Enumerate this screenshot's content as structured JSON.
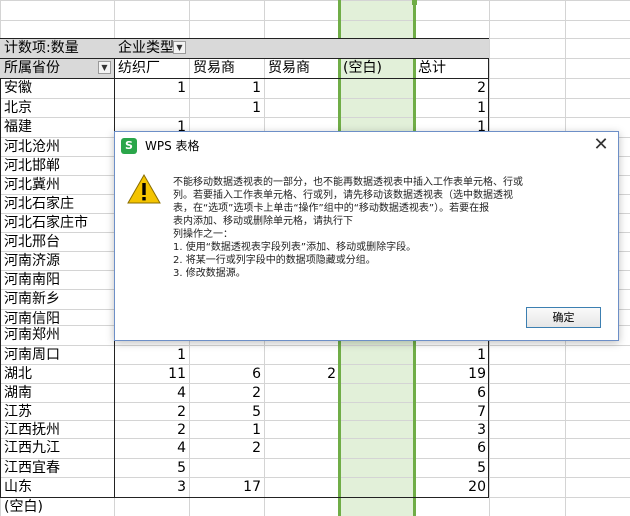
{
  "pivot": {
    "count_label": "计数项:数量",
    "col_field": "企业类型",
    "row_field": "所属省份",
    "col_headers": [
      "纺织厂",
      "贸易商",
      "贸易商",
      "(空白)",
      "总计"
    ],
    "rows": [
      {
        "name": "安徽",
        "vals": [
          "1",
          "1",
          "",
          "",
          "2"
        ]
      },
      {
        "name": "北京",
        "vals": [
          "",
          "1",
          "",
          "",
          "1"
        ]
      },
      {
        "name": "福建",
        "vals": [
          "1",
          "",
          "",
          "",
          "1"
        ]
      },
      {
        "name": "河北沧州",
        "vals": [
          "",
          "",
          "",
          "",
          ""
        ]
      },
      {
        "name": "河北邯郸",
        "vals": [
          "",
          "",
          "",
          "",
          ""
        ]
      },
      {
        "name": "河北冀州",
        "vals": [
          "",
          "",
          "",
          "",
          ""
        ]
      },
      {
        "name": "河北石家庄",
        "vals": [
          "",
          "",
          "",
          "",
          ""
        ]
      },
      {
        "name": "河北石家庄市",
        "vals": [
          "",
          "",
          "",
          "",
          ""
        ]
      },
      {
        "name": "河北邢台",
        "vals": [
          "",
          "",
          "",
          "",
          ""
        ]
      },
      {
        "name": "河南济源",
        "vals": [
          "",
          "",
          "",
          "",
          ""
        ]
      },
      {
        "name": "河南南阳",
        "vals": [
          "",
          "",
          "",
          "",
          ""
        ]
      },
      {
        "name": "河南新乡",
        "vals": [
          "",
          "",
          "",
          "",
          ""
        ]
      },
      {
        "name": "河南信阳",
        "vals": [
          "",
          "",
          "",
          "",
          ""
        ]
      },
      {
        "name": "河南郑州",
        "vals": [
          "",
          "",
          "",
          "",
          ""
        ]
      },
      {
        "name": "河南周口",
        "vals": [
          "1",
          "",
          "",
          "",
          "1"
        ]
      },
      {
        "name": "湖北",
        "vals": [
          "11",
          "6",
          "2",
          "",
          "19"
        ]
      },
      {
        "name": "湖南",
        "vals": [
          "4",
          "2",
          "",
          "",
          "6"
        ]
      },
      {
        "name": "江苏",
        "vals": [
          "2",
          "5",
          "",
          "",
          "7"
        ]
      },
      {
        "name": "江西抚州",
        "vals": [
          "2",
          "1",
          "",
          "",
          "3"
        ]
      },
      {
        "name": "江西九江",
        "vals": [
          "4",
          "2",
          "",
          "",
          "6"
        ]
      },
      {
        "name": "江西宜春",
        "vals": [
          "5",
          "",
          "",
          "",
          "5"
        ]
      },
      {
        "name": "山东",
        "vals": [
          "3",
          "17",
          "",
          "",
          "20"
        ]
      },
      {
        "name": "(空白)",
        "vals": [
          "",
          "",
          "",
          "",
          ""
        ]
      }
    ]
  },
  "dialog": {
    "title": "WPS 表格",
    "message_lines": [
      "不能移动数据透视表的一部分，也不能再数据透视表中插入工作表单元格、行或",
      "列。若要插入工作表单元格、行或列，请先移动该数据透视表（选中数据透视",
      "表，在“选项”选项卡上单击“操作”组中的“移动数据透视表”）。若要在报",
      "表内添加、移动或删除单元格，请执行下",
      "列操作之一：",
      "1. 使用“数据透视表字段列表”添加、移动或删除字段。",
      "2. 将某一行或列字段中的数据项隐藏或分组。",
      "3. 修改数据源。"
    ],
    "ok_label": "确定"
  },
  "colors": {
    "grid": "#d4d4d4",
    "selected_col_fill": "#e2f0d9",
    "selected_col_border": "#70ad47",
    "dialog_border": "#6d8fc7"
  }
}
